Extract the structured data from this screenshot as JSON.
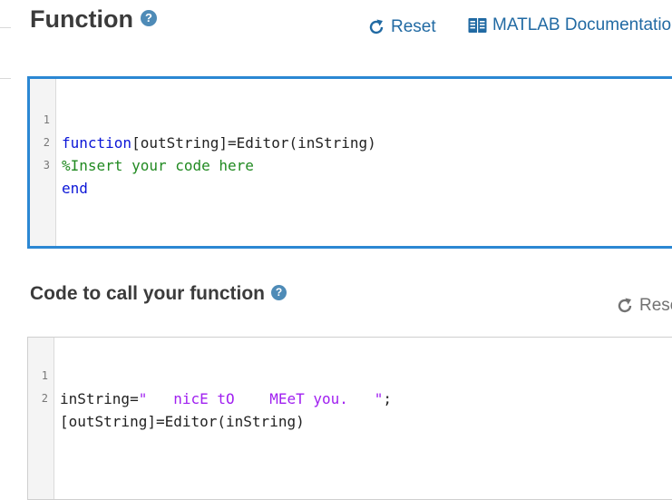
{
  "function_section": {
    "title": "Function",
    "help_icon": "question-circle-icon",
    "reset_label": "Reset",
    "doc_label": "MATLAB Documentation",
    "editor": {
      "line_numbers": [
        "1",
        "2",
        "3"
      ],
      "lines": [
        {
          "keyword": "function",
          "rest": "[outString]=Editor(inString)"
        },
        {
          "comment": "%Insert your code here"
        },
        {
          "keyword": "end"
        }
      ]
    }
  },
  "call_section": {
    "title": "Code to call your function",
    "help_icon": "question-circle-icon",
    "reset_label": "Reset",
    "editor": {
      "line_numbers": [
        "1",
        "2"
      ],
      "lines": [
        {
          "prefix": "inString=",
          "string": "\"   nicE tO    MEeT you.   \"",
          "suffix": ";"
        },
        {
          "text": "[outString]=Editor(inString)"
        }
      ]
    }
  },
  "colors": {
    "accent": "#2b87d3",
    "link": "#216aa3",
    "keyword": "#0b16d7",
    "comment": "#218a21",
    "string": "#a020f0"
  }
}
